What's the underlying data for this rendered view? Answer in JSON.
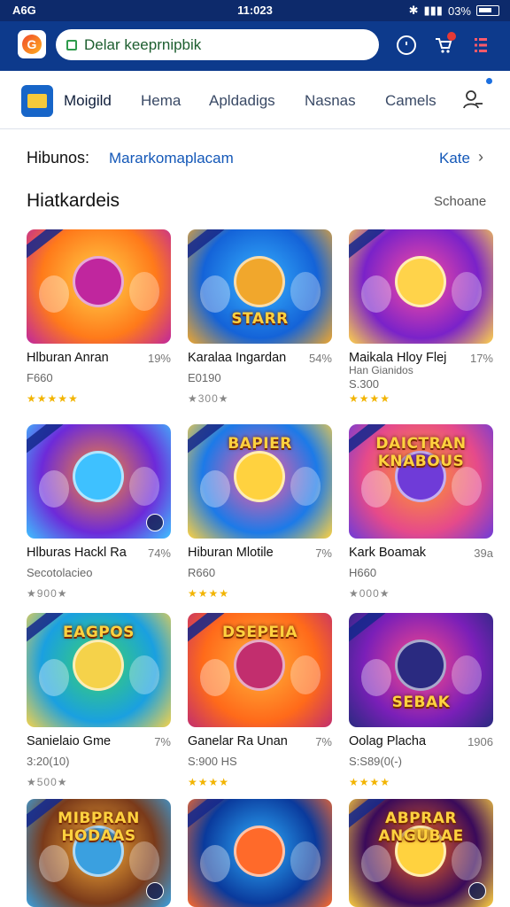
{
  "status": {
    "left": "A6G",
    "time": "11:023",
    "battery": "03%"
  },
  "search": {
    "value": "Delar keeprnipbik"
  },
  "logo_letter": "G",
  "tabs": [
    "Moigild",
    "Hema",
    "Apldadigs",
    "Nasnas",
    "Camels"
  ],
  "link_row": {
    "label": "Hibunos:",
    "value": "Mararkomaplacam",
    "more": "Kate"
  },
  "section": {
    "title": "Hiatkardeis",
    "action": "Schoane"
  },
  "cards": [
    {
      "name": "Hlburan Anran",
      "pct": "19%",
      "sub": "F660",
      "stars": "★★★★★",
      "banner": "",
      "colors": [
        "#ff7a1a",
        "#ffd24a",
        "#c0269e"
      ]
    },
    {
      "name": "Karalaa Ingardan",
      "pct": "54%",
      "sub": "E0190",
      "stars": "★300★",
      "banner": "STARR",
      "colors": [
        "#1463d8",
        "#37b3ff",
        "#f1a72c"
      ]
    },
    {
      "name": "Maikala Hloy Flej",
      "pct": "17%",
      "sub": "S.300",
      "sub2": "Han Gianidos",
      "stars": "★★★★",
      "banner": "",
      "colors": [
        "#7a22c9",
        "#ff4ea0",
        "#ffd34a"
      ]
    },
    {
      "name": "Hlburas Hackl Ra",
      "pct": "74%",
      "sub": "Secotolacieo",
      "stars": "★900★",
      "banner": "",
      "colors": [
        "#6d2ad9",
        "#ff8a2a",
        "#3ec1ff"
      ]
    },
    {
      "name": "Hiburan Mlotile",
      "pct": "7%",
      "sub": "R660",
      "stars": "★★★★",
      "banner": "BAPIER",
      "colors": [
        "#1c7ae8",
        "#ff5aa0",
        "#ffd23f"
      ]
    },
    {
      "name": "Kark Boamak",
      "pct": "39a",
      "sub": "H660",
      "stars": "★000★",
      "banner": "DAICTRAN KNABOUS",
      "colors": [
        "#e64a8a",
        "#ff9a2a",
        "#6f3bd8"
      ]
    },
    {
      "name": "Sanielaio Gme",
      "pct": "7%",
      "sub": "3:20(10)",
      "stars": "★500★",
      "banner": "EAGPOS",
      "colors": [
        "#1aa0e0",
        "#3bd36a",
        "#f5d24a"
      ]
    },
    {
      "name": "Ganelar Ra Unan",
      "pct": "7%",
      "sub": "S:900 HS",
      "stars": "★★★★",
      "banner": "DSEPEIA",
      "colors": [
        "#ff6a1a",
        "#ffb33a",
        "#c22e6e"
      ]
    },
    {
      "name": "Oolag Placha",
      "pct": "1906",
      "sub": "S:S89(0(-)",
      "stars": "★★★★",
      "banner": "SEBAK",
      "colors": [
        "#7a1fb8",
        "#ff4a8a",
        "#2a2a80"
      ]
    },
    {
      "name": "",
      "pct": "",
      "sub": "",
      "stars": "",
      "banner": "MIBPRAN HODAAS",
      "colors": [
        "#7a3a1a",
        "#ffb33a",
        "#3aa0e0"
      ]
    },
    {
      "name": "",
      "pct": "",
      "sub": "",
      "stars": "",
      "banner": "",
      "colors": [
        "#0a3a9c",
        "#2fb0ff",
        "#ff6a2a"
      ]
    },
    {
      "name": "",
      "pct": "",
      "sub": "",
      "stars": "",
      "banner": "ABPRAR ANGUBAE",
      "colors": [
        "#3a0a5a",
        "#ff6a1a",
        "#ffd23f"
      ]
    }
  ]
}
